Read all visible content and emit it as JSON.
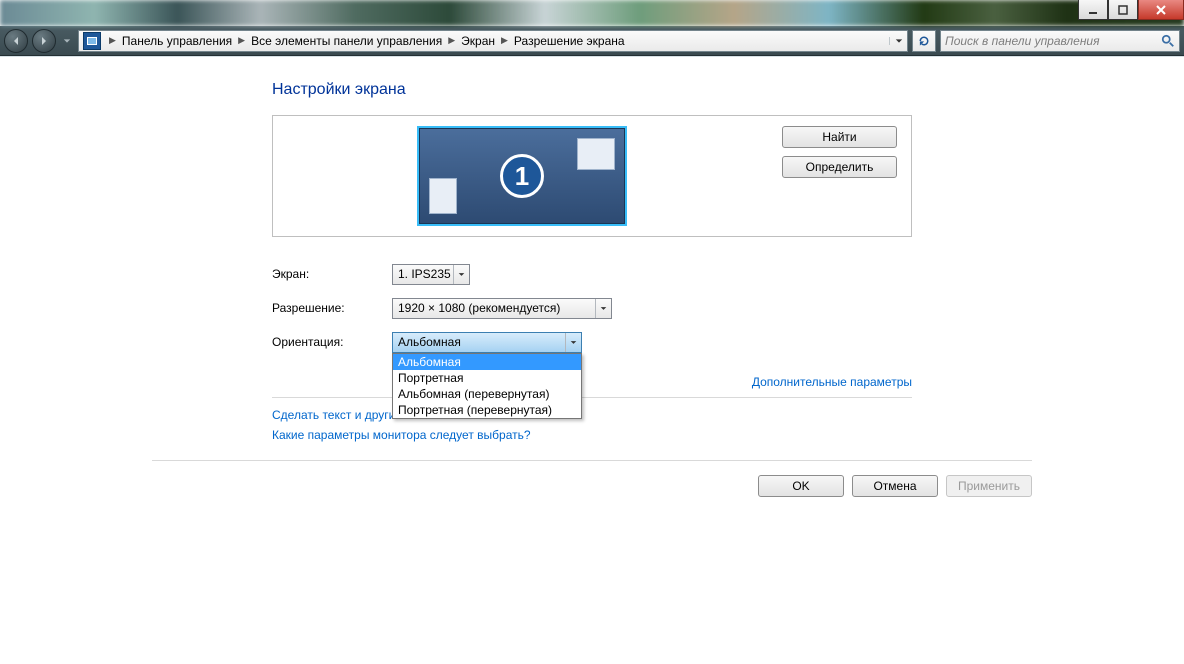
{
  "window_controls": {
    "minimize": "_",
    "maximize": "□",
    "close": "×"
  },
  "breadcrumb": {
    "items": [
      "Панель управления",
      "Все элементы панели управления",
      "Экран",
      "Разрешение экрана"
    ]
  },
  "search": {
    "placeholder": "Поиск в панели управления"
  },
  "page_title": "Настройки экрана",
  "preview": {
    "monitor_number": "1"
  },
  "buttons": {
    "find": "Найти",
    "identify": "Определить",
    "ok": "OK",
    "cancel": "Отмена",
    "apply": "Применить"
  },
  "labels": {
    "screen": "Экран:",
    "resolution": "Разрешение:",
    "orientation": "Ориентация:"
  },
  "screen_combo": {
    "value": "1. IPS235"
  },
  "resolution_combo": {
    "value": "1920 × 1080 (рекомендуется)"
  },
  "orientation_combo": {
    "value": "Альбомная",
    "options": [
      "Альбомная",
      "Портретная",
      "Альбомная (перевернутая)",
      "Портретная (перевернутая)"
    ],
    "selected_index": 0
  },
  "links": {
    "advanced": "Дополнительные параметры",
    "text_size_truncated": "Сделать текст и другие",
    "which_params": "Какие параметры монитора следует выбрать?"
  }
}
